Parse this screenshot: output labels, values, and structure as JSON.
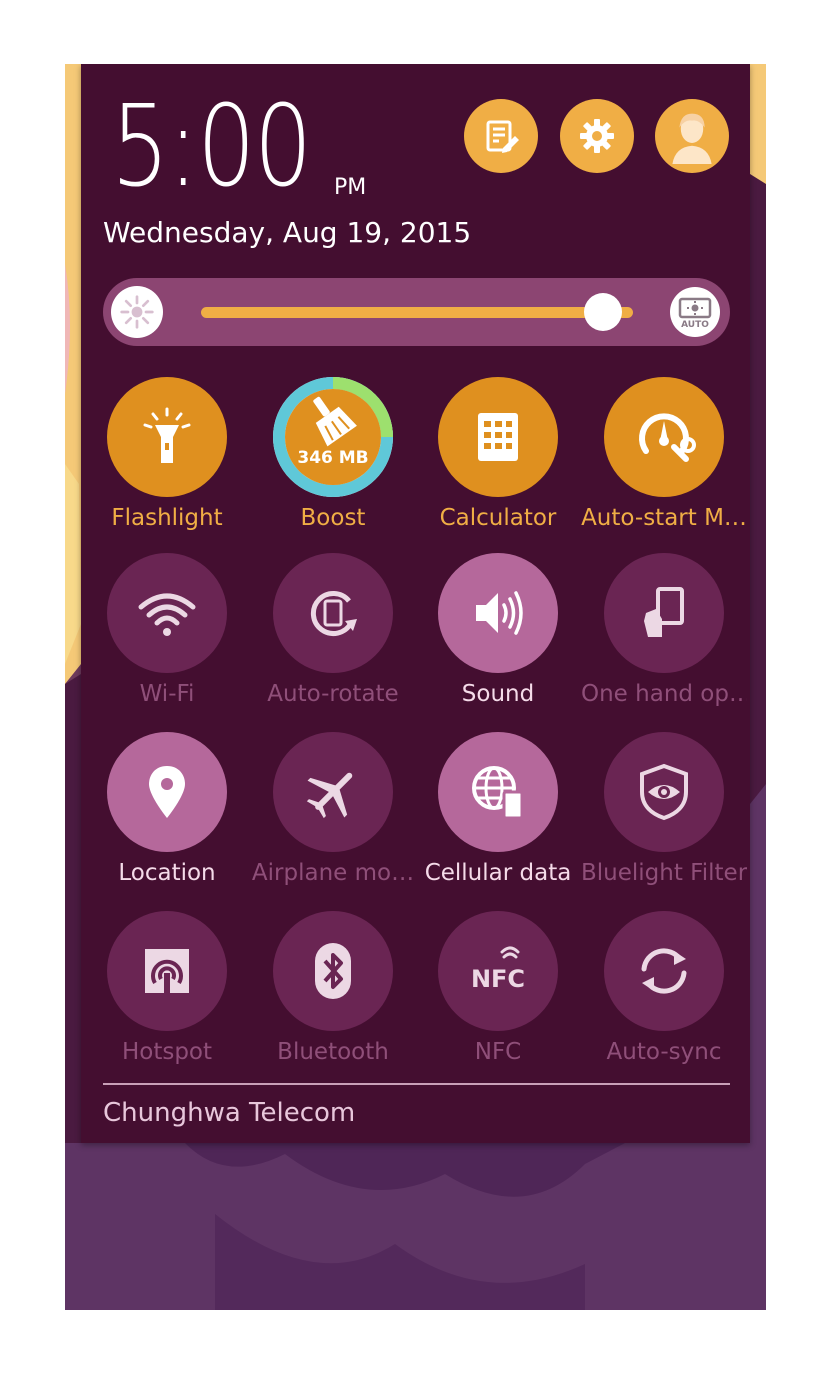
{
  "clock": {
    "time": "5:00",
    "ampm": "PM",
    "date": "Wednesday, Aug 19, 2015"
  },
  "header_buttons": [
    {
      "name": "edit-notes-icon"
    },
    {
      "name": "settings-gear-icon"
    },
    {
      "name": "user-avatar-icon"
    }
  ],
  "brightness": {
    "level": 0.93,
    "auto_label": "AUTO"
  },
  "tiles": [
    {
      "label": "Flashlight",
      "icon": "flashlight-icon",
      "state": "orange"
    },
    {
      "label": "Boost",
      "icon": "boost-broom-icon",
      "state": "boost",
      "value": "346 MB"
    },
    {
      "label": "Calculator",
      "icon": "calculator-icon",
      "state": "orange"
    },
    {
      "label": "Auto-start M…",
      "icon": "auto-start-manager-icon",
      "state": "orange"
    },
    {
      "label": "Wi-Fi",
      "icon": "wifi-icon",
      "state": "off"
    },
    {
      "label": "Auto-rotate",
      "icon": "auto-rotate-icon",
      "state": "off"
    },
    {
      "label": "Sound",
      "icon": "sound-icon",
      "state": "on"
    },
    {
      "label": "One hand op…",
      "icon": "one-hand-operation-icon",
      "state": "off"
    },
    {
      "label": "Location",
      "icon": "location-pin-icon",
      "state": "on"
    },
    {
      "label": "Airplane mo…",
      "icon": "airplane-icon",
      "state": "off"
    },
    {
      "label": "Cellular data",
      "icon": "cellular-data-globe-icon",
      "state": "on"
    },
    {
      "label": "Bluelight Filter",
      "icon": "bluelight-filter-eye-icon",
      "state": "off"
    },
    {
      "label": "Hotspot",
      "icon": "hotspot-icon",
      "state": "off"
    },
    {
      "label": "Bluetooth",
      "icon": "bluetooth-icon",
      "state": "off"
    },
    {
      "label": "NFC",
      "icon": "nfc-icon",
      "state": "off"
    },
    {
      "label": "Auto-sync",
      "icon": "auto-sync-icon",
      "state": "off"
    }
  ],
  "carrier": "Chunghwa Telecom",
  "colors": {
    "panel": "#440e30",
    "accent_orange": "#df901f",
    "header_button": "#f0ae45",
    "tile_on": "#b5689b",
    "tile_off": "#6a2553",
    "boost_ring": "#5fc8d8"
  }
}
